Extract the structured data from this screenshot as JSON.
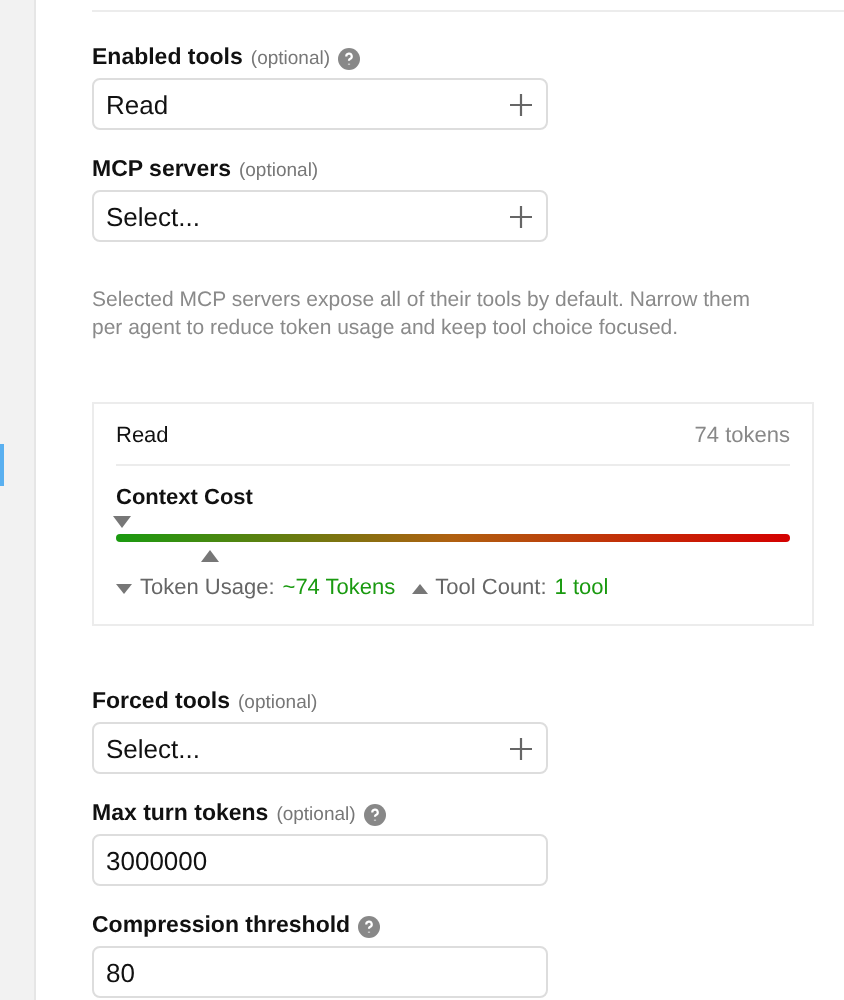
{
  "fields_top": [
    {
      "kind": "select",
      "label": "Enabled tools",
      "optional": "(optional)",
      "help": true,
      "value": "Read"
    },
    {
      "kind": "select",
      "label": "MCP servers",
      "optional": "(optional)",
      "help": false,
      "placeholder": "Select..."
    }
  ],
  "note": "Selected MCP servers expose all of their tools by default. Narrow them per agent to reduce token usage and keep tool choice focused.",
  "cost_card": {
    "tool": "Read",
    "tokens": "74 tokens",
    "title": "Context Cost",
    "token_marker": {
      "level": 0.01
    },
    "tool_marker": {
      "level": 0.14
    },
    "legend": [
      {
        "kind": "down",
        "label": "Token Usage:",
        "value": "~74 Tokens"
      },
      {
        "kind": "up",
        "label": "Tool Count:",
        "value": "1 tool"
      }
    ]
  },
  "fields_bottom": [
    {
      "kind": "select",
      "label": "Forced tools",
      "optional": "(optional)",
      "help": false,
      "placeholder": "Select..."
    },
    {
      "kind": "input",
      "label": "Max turn tokens",
      "optional": "(optional)",
      "help": true,
      "value": "3000000"
    },
    {
      "kind": "input",
      "label": "Compression threshold",
      "help": true,
      "value": "80"
    }
  ]
}
